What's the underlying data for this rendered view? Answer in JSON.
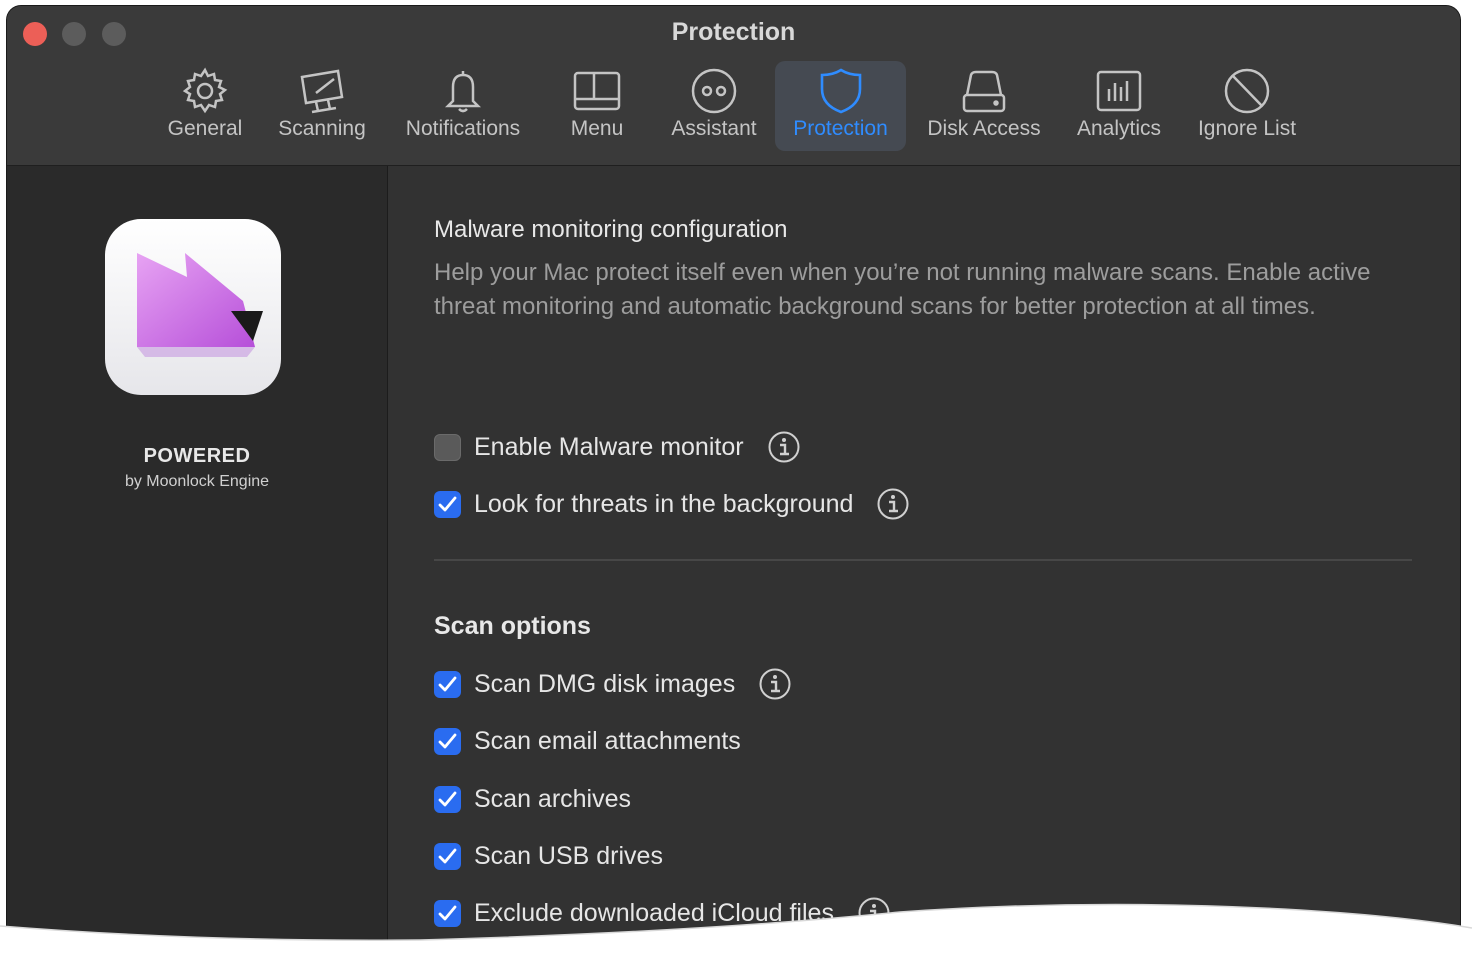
{
  "window": {
    "title": "Protection"
  },
  "colors": {
    "accent": "#2f8cff",
    "checkbox_on": "#2a6cf0",
    "close": "#ec5f57"
  },
  "toolbar": [
    {
      "label": "General",
      "icon": "gear-icon",
      "active": false
    },
    {
      "label": "Scanning",
      "icon": "monitor-scan-icon",
      "active": false
    },
    {
      "label": "Notifications",
      "icon": "bell-icon",
      "active": false
    },
    {
      "label": "Menu",
      "icon": "menu-panel-icon",
      "active": false
    },
    {
      "label": "Assistant",
      "icon": "assistant-face-icon",
      "active": false
    },
    {
      "label": "Protection",
      "icon": "shield-icon",
      "active": true
    },
    {
      "label": "Disk Access",
      "icon": "disk-icon",
      "active": false
    },
    {
      "label": "Analytics",
      "icon": "bar-chart-icon",
      "active": false
    },
    {
      "label": "Ignore List",
      "icon": "prohibited-icon",
      "active": false
    }
  ],
  "sidebar": {
    "powered": "POWERED",
    "byline": "by Moonlock Engine"
  },
  "main": {
    "heading": "Malware monitoring configuration",
    "description": "Help your Mac protect itself even when you’re not running malware scans. Enable active threat monitoring and automatic background scans for better protection at all times.",
    "monitor_options": [
      {
        "label": "Enable Malware monitor",
        "checked": false,
        "info": true
      },
      {
        "label": "Look for threats in the background",
        "checked": true,
        "info": true
      }
    ],
    "scan_heading": "Scan options",
    "scan_options": [
      {
        "label": "Scan DMG disk images",
        "checked": true,
        "info": true
      },
      {
        "label": "Scan email attachments",
        "checked": true,
        "info": false
      },
      {
        "label": "Scan archives",
        "checked": true,
        "info": false
      },
      {
        "label": "Scan USB drives",
        "checked": true,
        "info": false
      },
      {
        "label": "Exclude downloaded iCloud files",
        "checked": true,
        "info": true
      }
    ]
  }
}
